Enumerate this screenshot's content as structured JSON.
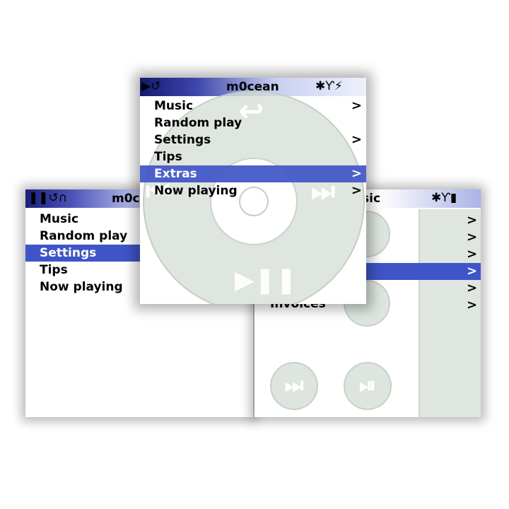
{
  "left_screen": {
    "status_icons": "❚❚↺∩",
    "title": "m0c",
    "menu": [
      {
        "label": "Music",
        "selected": false
      },
      {
        "label": "Random play",
        "selected": false
      },
      {
        "label": "Settings",
        "selected": true
      },
      {
        "label": "Tips",
        "selected": false
      },
      {
        "label": "Now playing",
        "selected": false
      }
    ]
  },
  "right_screen": {
    "title": "sic",
    "status_icons": "✱Ƴ▮",
    "hidden_item": "Invoices",
    "chevrons": [
      ">",
      ">",
      ">",
      ">",
      ">",
      ">"
    ],
    "buttons": [
      "⏭",
      "⏯"
    ]
  },
  "center_screen": {
    "status_left": "▶↺",
    "title": "m0cean",
    "status_right": "✱Ƴ⚡",
    "menu": [
      {
        "label": "Music",
        "selected": false,
        "chevron": ">"
      },
      {
        "label": "Random play",
        "selected": false,
        "chevron": ""
      },
      {
        "label": "Settings",
        "selected": false,
        "chevron": ">"
      },
      {
        "label": "Tips",
        "selected": false,
        "chevron": ""
      },
      {
        "label": "Extras",
        "selected": true,
        "chevron": ">"
      },
      {
        "label": "Now playing",
        "selected": false,
        "chevron": ">"
      }
    ],
    "wheel": {
      "menu_glyph": "↩",
      "next_glyph": "⏭",
      "prev_glyph": "⏮",
      "playpause_glyph": "▶❚❚"
    }
  },
  "colors": {
    "selection": "#3f55c7",
    "wheel": "#d6ded6"
  }
}
